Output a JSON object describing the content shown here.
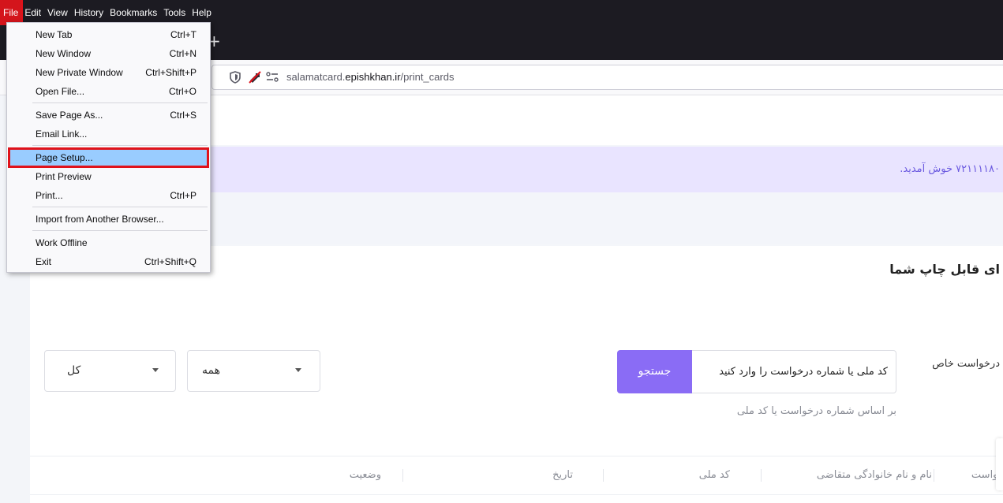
{
  "menubar": {
    "items": [
      "File",
      "Edit",
      "View",
      "History",
      "Bookmarks",
      "Tools",
      "Help"
    ]
  },
  "tabstrip": {
    "new_tab_symbol": "+"
  },
  "urlbar": {
    "prefix": "salamatcard.",
    "host": "epishkhan.ir",
    "path": "/print_cards"
  },
  "file_menu": {
    "items": [
      {
        "label": "New Tab",
        "shortcut": "Ctrl+T"
      },
      {
        "label": "New Window",
        "shortcut": "Ctrl+N"
      },
      {
        "label": "New Private Window",
        "shortcut": "Ctrl+Shift+P"
      },
      {
        "label": "Open File...",
        "shortcut": "Ctrl+O"
      },
      {
        "label": "Save Page As...",
        "shortcut": "Ctrl+S"
      },
      {
        "label": "Email Link...",
        "shortcut": ""
      },
      {
        "label": "Page Setup...",
        "shortcut": ""
      },
      {
        "label": "Print Preview",
        "shortcut": ""
      },
      {
        "label": "Print...",
        "shortcut": "Ctrl+P"
      },
      {
        "label": "Import from Another Browser...",
        "shortcut": ""
      },
      {
        "label": "Work Offline",
        "shortcut": ""
      },
      {
        "label": "Exit",
        "shortcut": "Ctrl+Shift+Q"
      }
    ],
    "highlighted": "Page Setup..."
  },
  "page": {
    "welcome": "۷۲۱۱۱۱۸۰ خوش آمدید.",
    "card_title": "ای قابل چاپ شما",
    "filter_label": "درخواست خاص",
    "select_all_type": "کل",
    "select_all_status": "همه",
    "search_placeholder": "کد ملی یا شماره درخواست را وارد کنید",
    "search_button": "جستجو",
    "search_hint": "بر اساس شماره درخواست یا کد ملی",
    "table_headers": [
      "درخواست",
      "نام و نام خانوادگی متقاضی",
      "کد ملی",
      "تاریخ",
      "وضعیت"
    ]
  },
  "colors": {
    "browser_chrome": "#1c1b22",
    "accent_purple": "#8a6cf5",
    "welcome_bg": "#e9e4ff",
    "highlight_red": "#e0121a",
    "menu_highlight": "#99ccff"
  }
}
